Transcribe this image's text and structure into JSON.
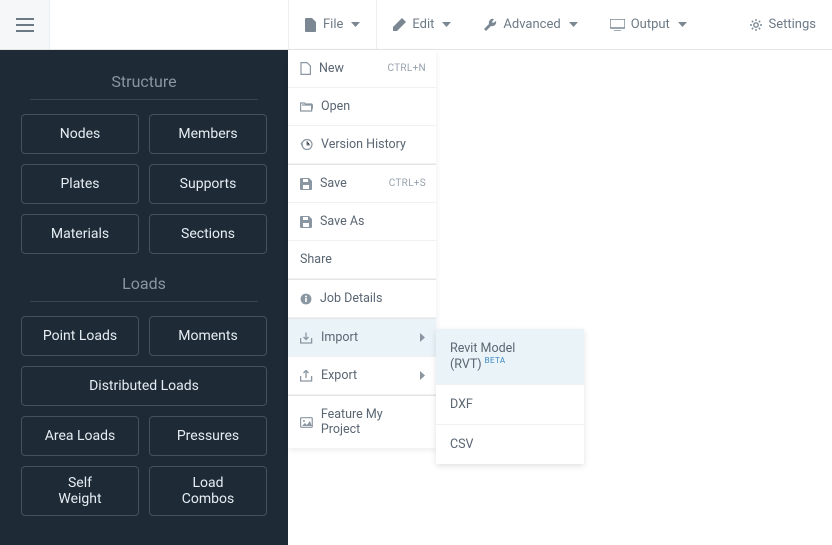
{
  "topbar": {
    "file": "File",
    "edit": "Edit",
    "advanced": "Advanced",
    "output": "Output",
    "settings": "Settings"
  },
  "sidebar": {
    "structure_title": "Structure",
    "loads_title": "Loads",
    "structure": {
      "nodes": "Nodes",
      "members": "Members",
      "plates": "Plates",
      "supports": "Supports",
      "materials": "Materials",
      "sections": "Sections"
    },
    "loads": {
      "point_loads": "Point Loads",
      "moments": "Moments",
      "distributed": "Distributed Loads",
      "area_loads": "Area Loads",
      "pressures": "Pressures",
      "self_weight_l1": "Self",
      "self_weight_l2": "Weight",
      "load_combos_l1": "Load",
      "load_combos_l2": "Combos"
    }
  },
  "file_menu": {
    "new": "New",
    "new_sc": "CTRL+N",
    "open": "Open",
    "version_history": "Version History",
    "save": "Save",
    "save_sc": "CTRL+S",
    "save_as": "Save As",
    "share": "Share",
    "job_details": "Job Details",
    "import": "Import",
    "export": "Export",
    "feature": "Feature My Project"
  },
  "import_submenu": {
    "revit": "Revit Model (RVT)",
    "revit_badge": "BETA",
    "dxf": "DXF",
    "csv": "CSV"
  }
}
